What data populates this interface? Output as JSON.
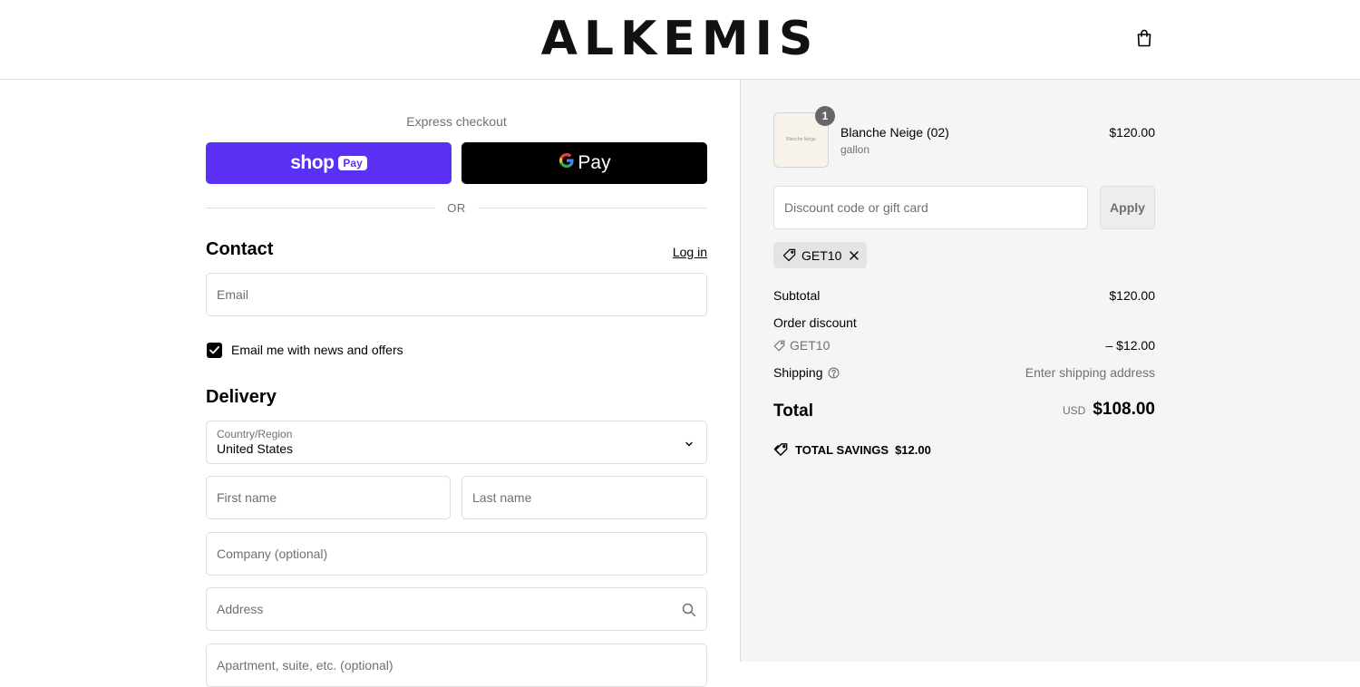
{
  "header": {
    "brand": "ALKEMIS",
    "cart_icon": "shopping-bag-icon"
  },
  "express": {
    "label": "Express checkout",
    "shop_pay": {
      "word": "shop",
      "badge": "Pay",
      "color": "#5a31f4"
    },
    "google_pay": {
      "g": "G",
      "text": "Pay"
    },
    "divider": "OR"
  },
  "contact": {
    "title": "Contact",
    "login": "Log in",
    "email_placeholder": "Email",
    "newsletter_label": "Email me with news and offers",
    "newsletter_checked": true
  },
  "delivery": {
    "title": "Delivery",
    "country_label": "Country/Region",
    "country_value": "United States",
    "first_name_placeholder": "First name",
    "last_name_placeholder": "Last name",
    "company_placeholder": "Company (optional)",
    "address_placeholder": "Address",
    "apartment_placeholder": "Apartment, suite, etc. (optional)"
  },
  "summary": {
    "item": {
      "name": "Blanche Neige (02)",
      "variant": "gallon",
      "price": "$120.00",
      "quantity": "1",
      "thumb_text": "Blanche Neige"
    },
    "discount_placeholder": "Discount code or gift card",
    "apply_label": "Apply",
    "applied_code": "GET10",
    "subtotal_label": "Subtotal",
    "subtotal_value": "$120.00",
    "order_discount_label": "Order discount",
    "discount_code": "GET10",
    "discount_value": "– $12.00",
    "shipping_label": "Shipping",
    "shipping_value": "Enter shipping address",
    "total_label": "Total",
    "currency": "USD",
    "total_value": "$108.00",
    "savings_label": "TOTAL SAVINGS",
    "savings_value": "$12.00"
  }
}
